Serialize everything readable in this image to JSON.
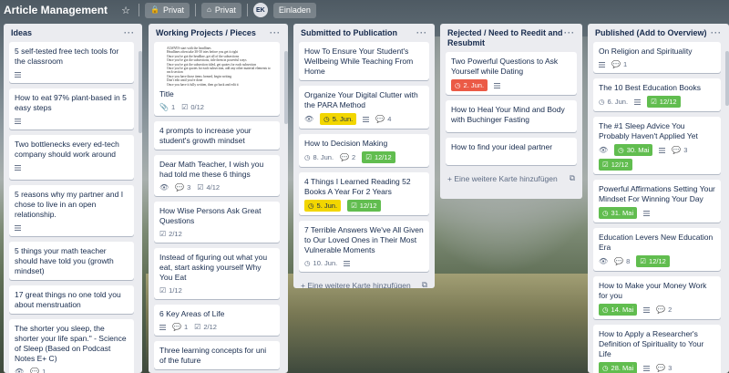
{
  "board": {
    "title": "Article Management",
    "visibility_label": "Privat",
    "team_label": "Privat",
    "avatar_initials": "EK",
    "invite_label": "Einladen"
  },
  "lists": [
    {
      "title": "Ideas",
      "cards": [
        {
          "title": "5 self-tested free tech tools for the classroom",
          "desc": true
        },
        {
          "title": "How to eat 97% plant-based in 5 easy steps",
          "desc": true
        },
        {
          "title": "Two bottlenecks every ed-tech company should work around",
          "desc": true
        },
        {
          "title": "5 reasons why my partner and I chose to live in an open relationship.",
          "desc": true
        },
        {
          "title": "5 things your math teacher should have told you (growth mindset)",
          "desc": false
        },
        {
          "title": "17 great things no one told you about menstruation",
          "desc": false
        },
        {
          "title": "The shorter you sleep, the shorter your life span.\" - Science of Sleep (Based on Podcast Notes E+ C)",
          "watch": true,
          "comments": "1"
        }
      ]
    },
    {
      "title": "Working Projects / Pieces",
      "cards": [
        {
          "cover_lines": [
            "ALWAYS start with the headlines",
            "Headlines often take 30-50 tries before you get it right",
            "Once you've got the headline, get all of the subsections",
            "Once you've got the subsections, title them in powerful ways",
            "Once you've got the subsection titled, get quotes for each subsection",
            "Once you've got quotes for each subsection, add any other material elements to each section",
            "Once you have those items formed, begin writing",
            "Don't edit until you're done",
            "Once you have it fully written, then go back and edit it"
          ],
          "title": "Title",
          "attachments": "1",
          "checklist": "0/12"
        },
        {
          "title": "4 prompts to increase your student's growth mindset"
        },
        {
          "title": "Dear Math Teacher, I wish you had told me these 6 things",
          "watch": true,
          "comments": "3",
          "checklist": "4/12"
        },
        {
          "title": "How Wise Persons Ask Great Questions",
          "checklist": "2/12"
        },
        {
          "title": "Instead of figuring out what you eat, start asking yourself Why You Eat",
          "checklist": "1/12"
        },
        {
          "title": "6 Key Areas of Life",
          "desc": true,
          "comments": "1",
          "checklist": "2/12"
        },
        {
          "title": "Three learning concepts for uni of the future"
        }
      ]
    },
    {
      "title": "Submitted to Publication",
      "cards": [
        {
          "title": "How To Ensure Your Student's Wellbeing While Teaching From Home"
        },
        {
          "title": "Organize Your Digital Clutter with the PARA Method",
          "watch": true,
          "due": "5. Jun.",
          "due_color": "yellow",
          "desc": true,
          "comments": "4"
        },
        {
          "title": "How to Decision Making",
          "due": "8. Jun.",
          "due_color": "none",
          "comments": "2",
          "checklist": "12/12",
          "checklist_done": true
        },
        {
          "title": "4 Things I Learned Reading 52 Books A Year For 2 Years",
          "due": "5. Jun.",
          "due_color": "yellow",
          "checklist": "12/12",
          "checklist_done": true
        },
        {
          "title": "7 Terrible Answers We've All Given to Our Loved Ones in Their Most Vulnerable Moments",
          "due": "10. Jun.",
          "due_color": "none",
          "desc": true
        }
      ],
      "add_label": "+ Eine weitere Karte hinzufügen"
    },
    {
      "title": "Rejected / Need to Reedit and Resubmit",
      "cards": [
        {
          "title": "Two Powerful Questions to Ask Yourself while Dating",
          "due": "2. Jun.",
          "due_color": "red",
          "desc": true
        },
        {
          "title": "How to Heal Your Mind and Body with Buchinger Fasting"
        },
        {
          "title": "How to find your ideal partner"
        }
      ],
      "add_label": "+ Eine weitere Karte hinzufügen"
    },
    {
      "title": "Published (Add to Overview)",
      "cards": [
        {
          "title": "On Religion and Spirituality",
          "desc": true,
          "comments": "1"
        },
        {
          "title": "The 10 Best Education Books",
          "due": "6. Jun.",
          "due_color": "none",
          "desc": true,
          "checklist": "12/12",
          "checklist_done": true
        },
        {
          "title": "The #1 Sleep Advice You Probably Haven't Applied Yet",
          "watch": true,
          "due": "30. Mai",
          "due_color": "green",
          "desc": true,
          "comments": "3",
          "checklist": "12/12",
          "checklist_done": true
        },
        {
          "title": "Powerful Affirmations Setting Your Mindset For Winning Your Day",
          "due": "31. Mai",
          "due_color": "green",
          "desc": true
        },
        {
          "title": "Education Levers New Education Era",
          "watch": true,
          "comments": "8",
          "checklist": "12/12",
          "checklist_done": true
        },
        {
          "title": "How to Make your Money Work for you",
          "due": "14. Mai",
          "due_color": "green",
          "desc": true,
          "comments": "2"
        },
        {
          "title": "How to Apply a Researcher's Definition of Spirituality to Your Life",
          "due": "28. Mai",
          "due_color": "green",
          "desc": true,
          "comments": "3"
        }
      ]
    }
  ]
}
